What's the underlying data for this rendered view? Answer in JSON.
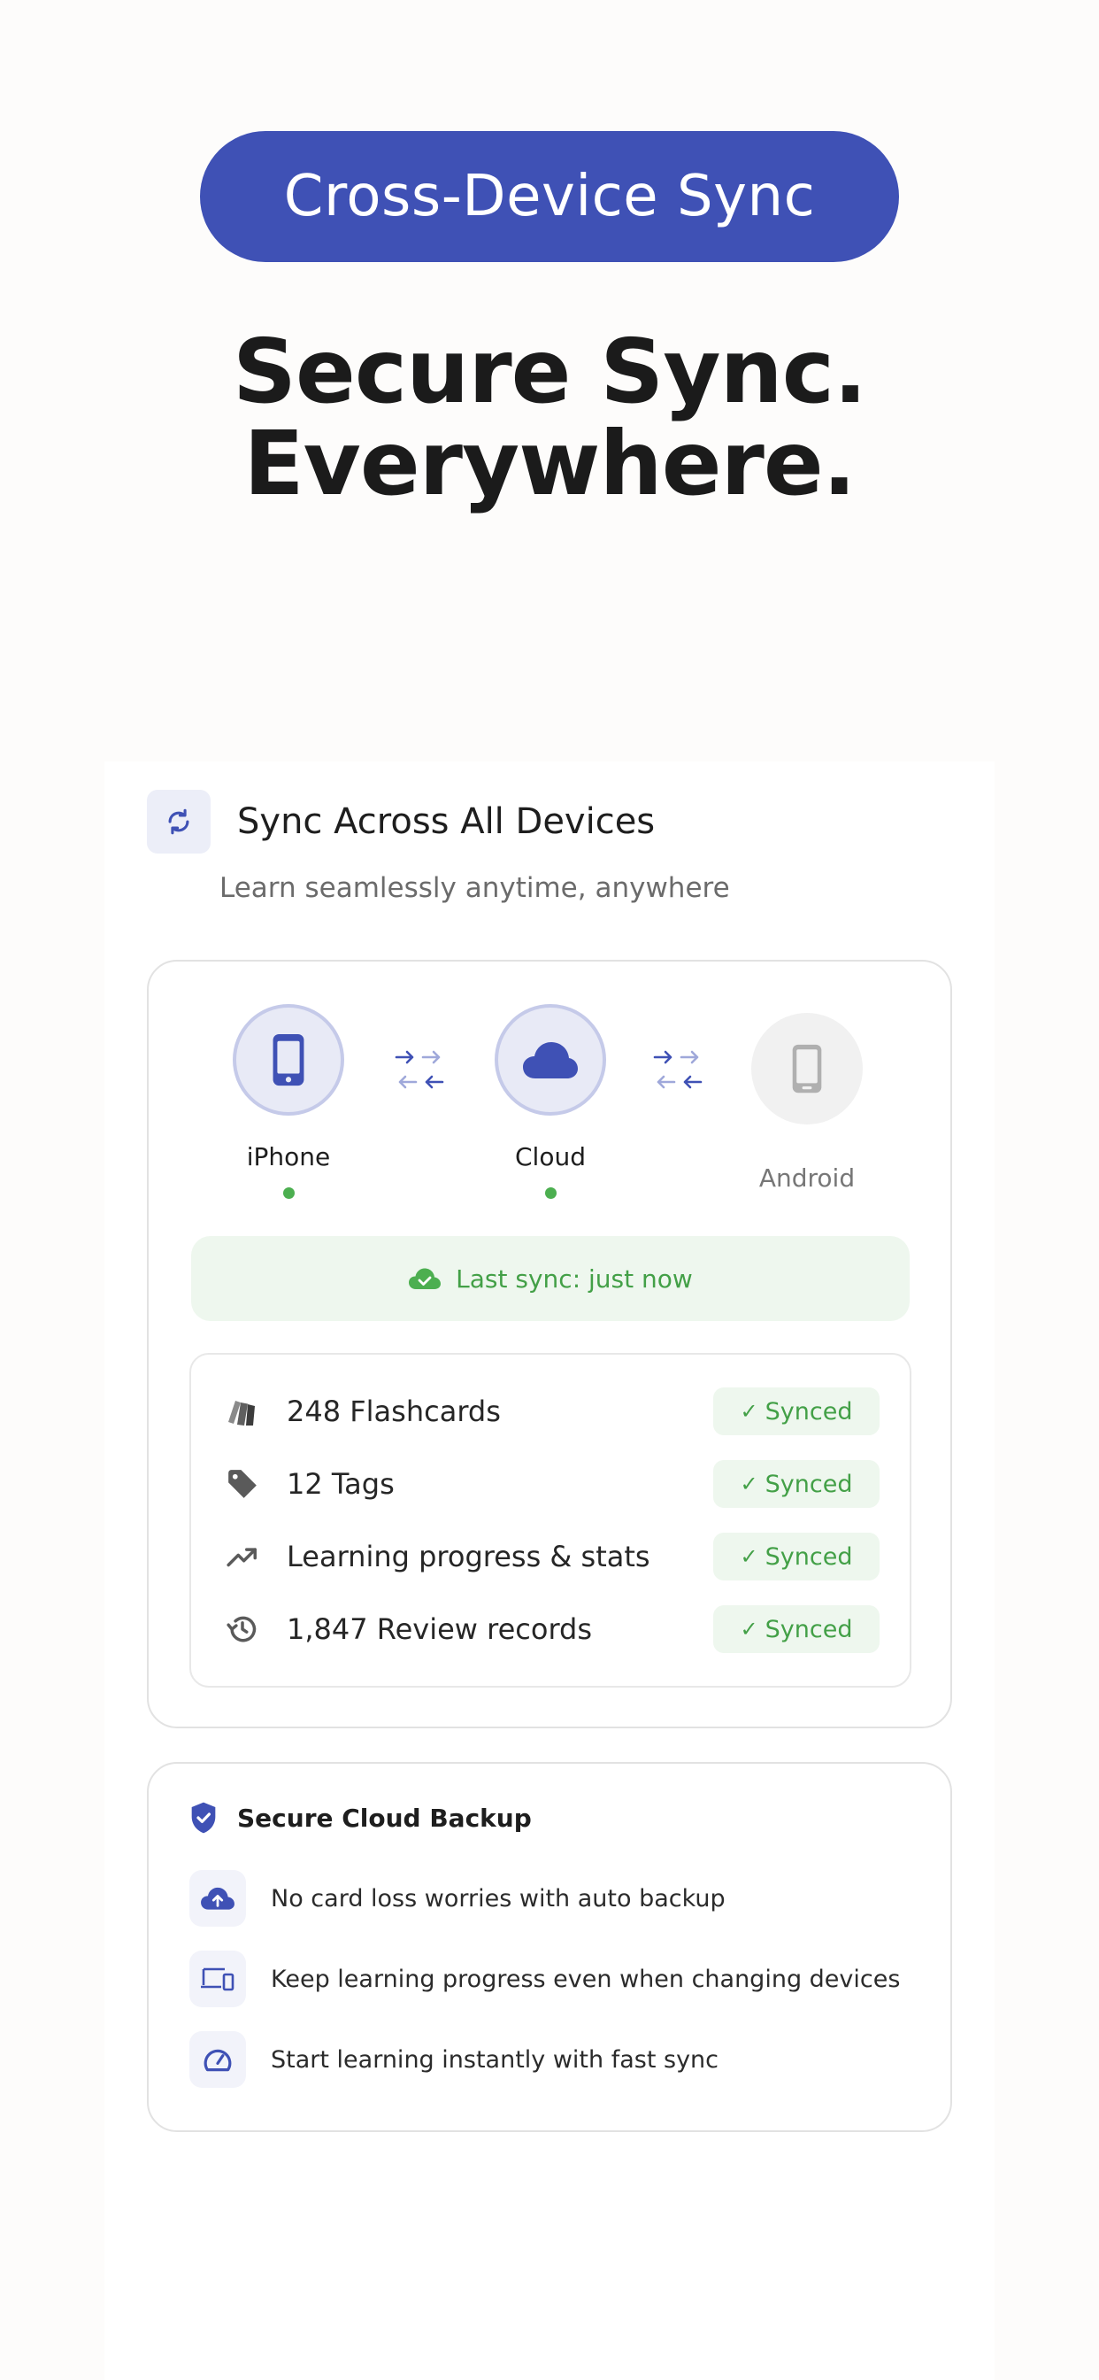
{
  "header": {
    "pill_label": "Cross-Device Sync",
    "headline_line1": "Secure Sync.",
    "headline_line2": "Everywhere."
  },
  "section": {
    "icon": "sync-icon",
    "title": "Sync Across All Devices",
    "subtitle": "Learn seamlessly anytime, anywhere"
  },
  "devices": [
    {
      "label": "iPhone",
      "icon": "phone-icon",
      "connected": true
    },
    {
      "label": "Cloud",
      "icon": "cloud-icon",
      "connected": true
    },
    {
      "label": "Android",
      "icon": "android-phone-icon",
      "connected": false
    }
  ],
  "last_sync": {
    "icon": "cloud-check-icon",
    "text": "Last sync: just now"
  },
  "sync_items": [
    {
      "icon": "flashcards-icon",
      "label": "248 Flashcards",
      "status": "Synced"
    },
    {
      "icon": "tag-icon",
      "label": "12 Tags",
      "status": "Synced"
    },
    {
      "icon": "trending-up-icon",
      "label": "Learning progress & stats",
      "status": "Synced"
    },
    {
      "icon": "history-icon",
      "label": "1,847 Review records",
      "status": "Synced"
    }
  ],
  "backup": {
    "icon": "shield-check-icon",
    "title": "Secure Cloud Backup",
    "items": [
      {
        "icon": "cloud-upload-icon",
        "text": "No card loss worries with auto backup"
      },
      {
        "icon": "devices-icon",
        "text": "Keep learning progress even when changing devices"
      },
      {
        "icon": "speedometer-icon",
        "text": "Start learning instantly with fast sync"
      }
    ]
  },
  "colors": {
    "primary": "#3f51b5",
    "success": "#43a047",
    "success_bg": "#eef7ee",
    "background": "#fdfcfb"
  }
}
